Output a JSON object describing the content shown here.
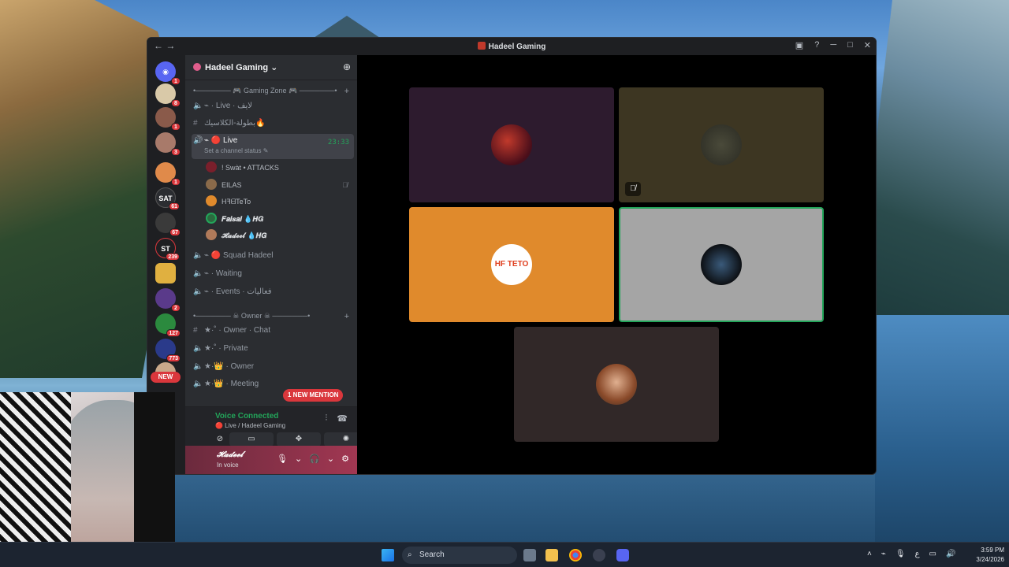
{
  "window": {
    "title": "Hadeel Gaming",
    "nav": "← →"
  },
  "servers": {
    "badges": [
      "1",
      "8",
      "1",
      "3",
      "1",
      "61",
      "67",
      "239",
      "2",
      "127",
      "773"
    ],
    "sat_label": "SAT",
    "st_label": "ST",
    "new_label": "NEW"
  },
  "guild": {
    "name": "Hadeel Gaming"
  },
  "categories": {
    "gaming_zone": "•─────── 🎮 Gaming Zone 🎮 ───────•",
    "owner": "•─────── ☠ Owner ☠ ───────•"
  },
  "channels": {
    "live_ar": "⌁ · Live · لايف",
    "tournament": "بطولة-الكلاسيك🔥",
    "live_active": "⌁ 🔴 Live",
    "live_time": "23:33",
    "live_status": "Set a channel status ✎",
    "squad": "⌁ 🔴 Squad Hadeel",
    "waiting": "⌁ · Waiting",
    "events": "⌁ · Events · فعاليات",
    "owner_chat": "★·˚ · Owner · Chat",
    "private": "★·˚ · Private",
    "owner_voice": "★·👑 · Owner",
    "meeting": "★·👑 · Meeting"
  },
  "voice_users": [
    {
      "name": "! Swàt • ATTACKS",
      "color": "#7a1f2b"
    },
    {
      "name": "EILAS",
      "color": "#8a6a4a"
    },
    {
      "name": "HꟻᗺTeTo",
      "color": "#e08a2c"
    },
    {
      "name": "𝑭𝒂𝒊𝒔𝒂𝒍 💧𝑯𝑮",
      "color": "#2b6b3f"
    },
    {
      "name": "𝓗𝓪𝓭𝓮𝓮𝓵 💧𝑯𝑮",
      "color": "#b07a5a"
    }
  ],
  "mention": "1 NEW MENTION",
  "voice_panel": {
    "title": "Voice Connected",
    "subtitle": "🔴 Live / Hadeel Gaming"
  },
  "user_panel": {
    "name": "𝓗𝓪𝓭𝓮𝓮𝓵",
    "status": "In voice"
  },
  "tiles": {
    "colors": [
      "#2d1b2e",
      "#3d3622",
      "#e08a2c",
      "#a5a5a5",
      "#312828"
    ],
    "teto_label": "HF TETO"
  },
  "taskbar": {
    "search": "Search",
    "time": "3:59 PM",
    "date": "3/24/2026",
    "lang": "ع"
  }
}
